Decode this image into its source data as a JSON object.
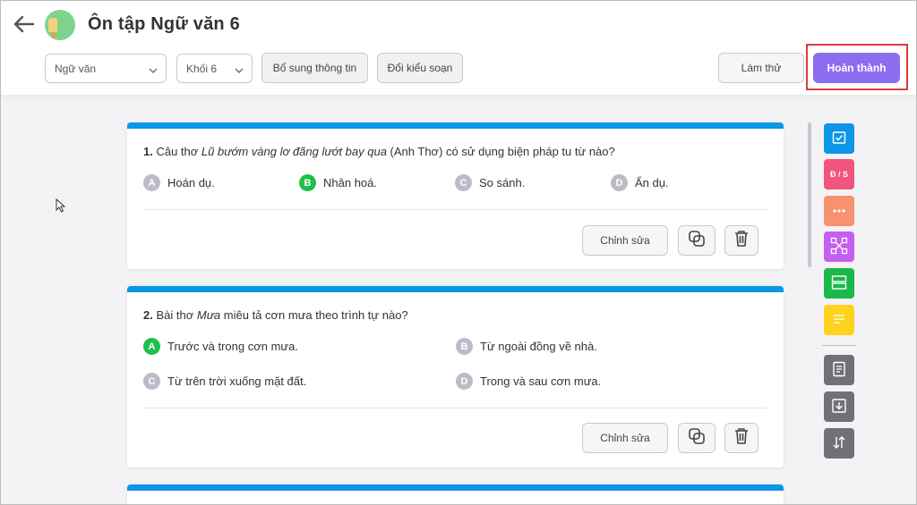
{
  "header": {
    "title": "Ôn tập Ngữ văn 6",
    "subject_select": "Ngữ văn",
    "grade_select": "Khối 6",
    "add_info_label": "Bổ sung thông tin",
    "change_type_label": "Đổi kiểu soạn",
    "try_label": "Làm thử",
    "done_label": "Hoàn thành"
  },
  "questions": [
    {
      "number": "1.",
      "text_pre": "Câu thơ ",
      "text_italic": "Lũ bướm vàng lơ đãng lướt bay qua",
      "text_post": " (Anh Thơ) có sử dụng biện pháp tu từ nào?",
      "options": [
        {
          "letter": "A",
          "text": "Hoán dụ."
        },
        {
          "letter": "B",
          "text": "Nhân hoá."
        },
        {
          "letter": "C",
          "text": "So sánh."
        },
        {
          "letter": "D",
          "text": "Ẩn dụ."
        }
      ],
      "correct": "B",
      "edit_label": "Chỉnh sửa"
    },
    {
      "number": "2.",
      "text_pre": "Bài thơ ",
      "text_italic": "Mưa",
      "text_post": " miêu tả cơn mưa theo trình tự nào?",
      "options": [
        {
          "letter": "A",
          "text": "Trước và trong cơn mưa."
        },
        {
          "letter": "B",
          "text": "Từ ngoài đồng về nhà."
        },
        {
          "letter": "C",
          "text": "Từ trên trời xuống mặt đất."
        },
        {
          "letter": "D",
          "text": "Trong và sau cơn mưa."
        }
      ],
      "correct": "A",
      "edit_label": "Chỉnh sửa"
    }
  ],
  "toolbar": {
    "true_false_label": "Đ / S",
    "colors": {
      "multiple_choice": "#0b96e6",
      "true_false": "#f1557d",
      "fill_blank": "#f7916f",
      "matching": "#c45ff0",
      "grouping": "#19b848",
      "essay": "#ffd21f",
      "utility": "#6f7078"
    }
  },
  "colors": {
    "accent": "#8c6cf0",
    "correct": "#1fbf4a",
    "card_top": "#0b96e6",
    "highlight": "#e03a3a"
  }
}
